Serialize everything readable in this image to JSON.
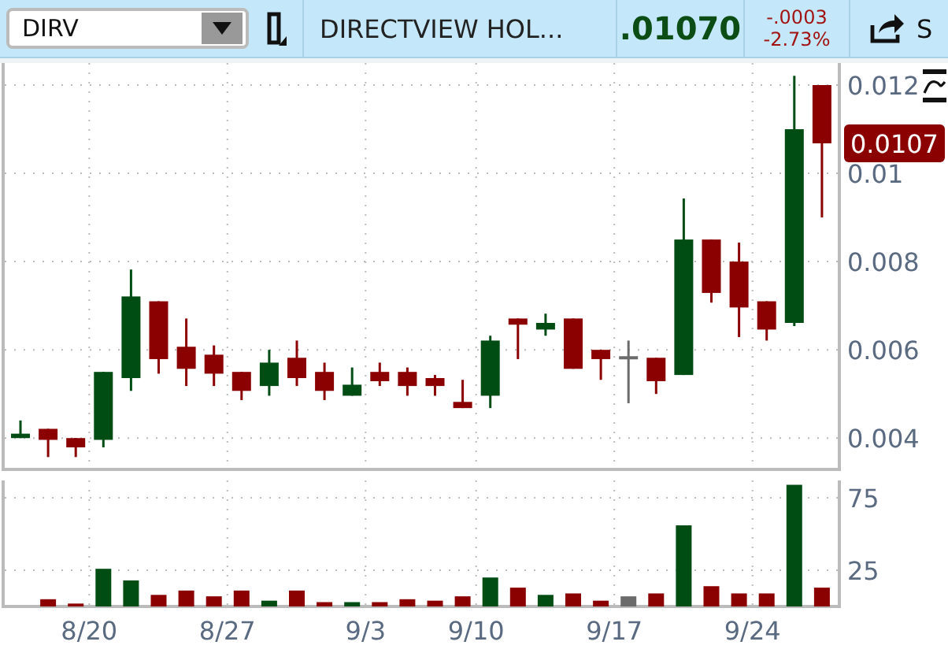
{
  "toolbar": {
    "symbol": "DIRV",
    "company": "DIRECTVIEW HOL...",
    "last": ".01070",
    "change": "-.0003",
    "change_percent": "-2.73%",
    "cut_label": "S"
  },
  "price_chart": {
    "chart_data": {
      "type": "candlestick",
      "grid": true,
      "ylim": [
        0.00329,
        0.0125
      ],
      "yticks": [
        0.004,
        0.006,
        0.008,
        0.01,
        0.012
      ],
      "categories": [
        null,
        null,
        null,
        null,
        null,
        null,
        null,
        null,
        null,
        null,
        null,
        null,
        null,
        null,
        null,
        null,
        null,
        null,
        null,
        null,
        null,
        null,
        null,
        null,
        null,
        null,
        null,
        null,
        null,
        null
      ],
      "ohlc": [
        [
          0.004,
          0.0044,
          0.004,
          0.0041
        ],
        [
          0.00421,
          0.00421,
          0.00357,
          0.00396
        ],
        [
          0.004,
          0.004,
          0.00357,
          0.00379
        ],
        [
          0.00396,
          0.0055,
          0.00379,
          0.0055
        ],
        [
          0.00536,
          0.00782,
          0.00507,
          0.00721
        ],
        [
          0.0071,
          0.0071,
          0.00546,
          0.00579
        ],
        [
          0.00607,
          0.00671,
          0.00518,
          0.00557
        ],
        [
          0.00589,
          0.0061,
          0.00518,
          0.00546
        ],
        [
          0.0055,
          0.0055,
          0.00486,
          0.00507
        ],
        [
          0.00518,
          0.006,
          0.00496,
          0.00571
        ],
        [
          0.00582,
          0.00621,
          0.00518,
          0.00536
        ],
        [
          0.0055,
          0.00571,
          0.00486,
          0.00507
        ],
        [
          0.00496,
          0.0056,
          0.00496,
          0.00521
        ],
        [
          0.0055,
          0.00571,
          0.00518,
          0.00529
        ],
        [
          0.0055,
          0.0056,
          0.00496,
          0.00518
        ],
        [
          0.00536,
          0.00543,
          0.00496,
          0.00518
        ],
        [
          0.00482,
          0.00532,
          0.00468,
          0.00468
        ],
        [
          0.00496,
          0.00632,
          0.00468,
          0.00621
        ],
        [
          0.00671,
          0.00671,
          0.00579,
          0.00657
        ],
        [
          0.00646,
          0.00682,
          0.00632,
          0.00661
        ],
        [
          0.00671,
          0.00671,
          0.00557,
          0.00557
        ],
        [
          0.006,
          0.006,
          0.00532,
          0.00579
        ],
        [
          0.00582,
          0.00621,
          0.00479,
          0.00582
        ],
        [
          0.00582,
          0.00582,
          0.005,
          0.00529
        ],
        [
          0.00543,
          0.00943,
          0.00543,
          0.0085
        ],
        [
          0.0085,
          0.0085,
          0.00707,
          0.00729
        ],
        [
          0.008,
          0.00843,
          0.00629,
          0.00696
        ],
        [
          0.0071,
          0.0071,
          0.00621,
          0.00646
        ],
        [
          0.00661,
          0.01221,
          0.00654,
          0.011
        ],
        [
          0.012,
          0.012,
          0.009,
          0.01068
        ]
      ]
    },
    "last_price_label": "0.0107"
  },
  "volume_chart": {
    "chart_data": {
      "type": "bar",
      "grid": true,
      "ylim": [
        0,
        87
      ],
      "yticks": [
        25,
        75
      ],
      "categories": [
        null,
        null,
        null,
        "8/20",
        null,
        null,
        null,
        null,
        "8/27",
        null,
        null,
        null,
        null,
        "9/3",
        null,
        null,
        null,
        "9/10",
        null,
        null,
        null,
        null,
        "9/17",
        null,
        null,
        null,
        null,
        "9/24",
        null,
        null
      ],
      "series": [
        {
          "values": [
            0,
            5,
            2,
            26,
            18,
            8,
            11,
            7,
            11,
            4,
            11,
            3,
            3,
            3,
            5,
            4,
            7,
            20,
            13,
            8,
            9,
            4,
            7,
            9,
            56,
            14,
            9,
            9,
            84,
            13
          ]
        }
      ]
    }
  }
}
